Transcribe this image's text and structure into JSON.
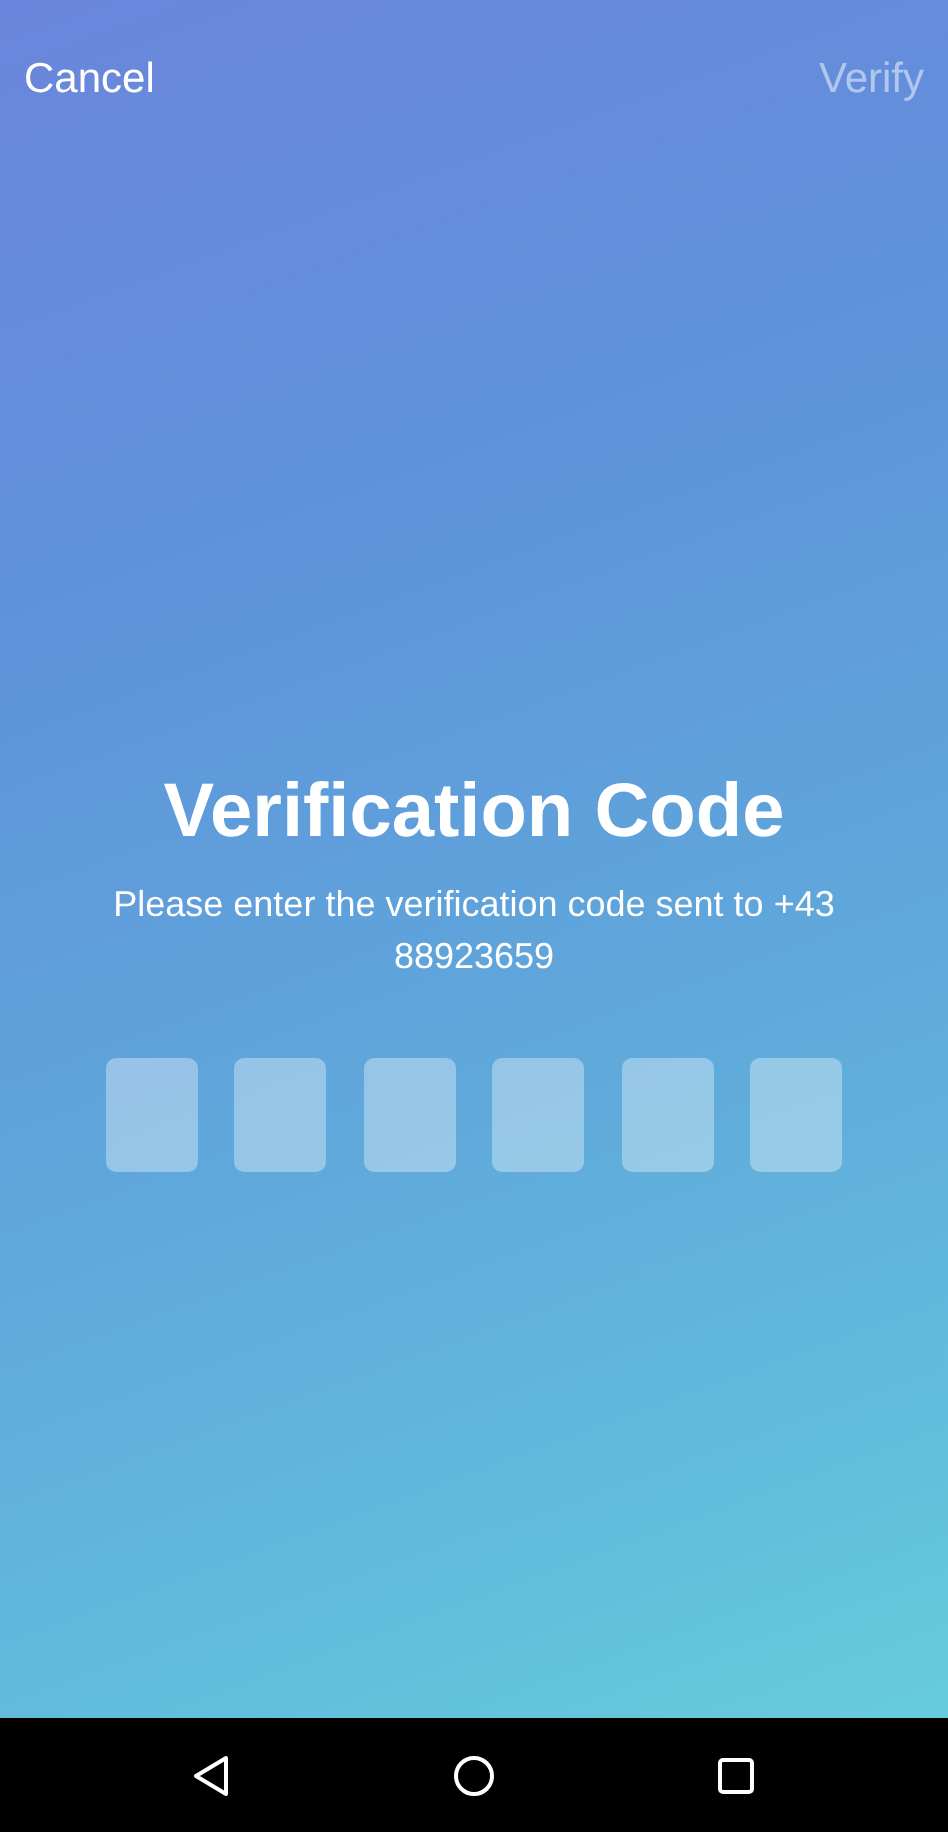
{
  "header": {
    "cancel": {
      "label": "Cancel"
    },
    "verify": {
      "label": "Verify",
      "disabled": true
    }
  },
  "title": "Verification Code",
  "message": "Please enter the verification code sent to +43 88923659",
  "code_boxes": [
    {
      "filled": false
    },
    {
      "filled": false
    },
    {
      "filled": false
    },
    {
      "filled": false
    },
    {
      "filled": false
    },
    {
      "filled": false
    }
  ]
}
